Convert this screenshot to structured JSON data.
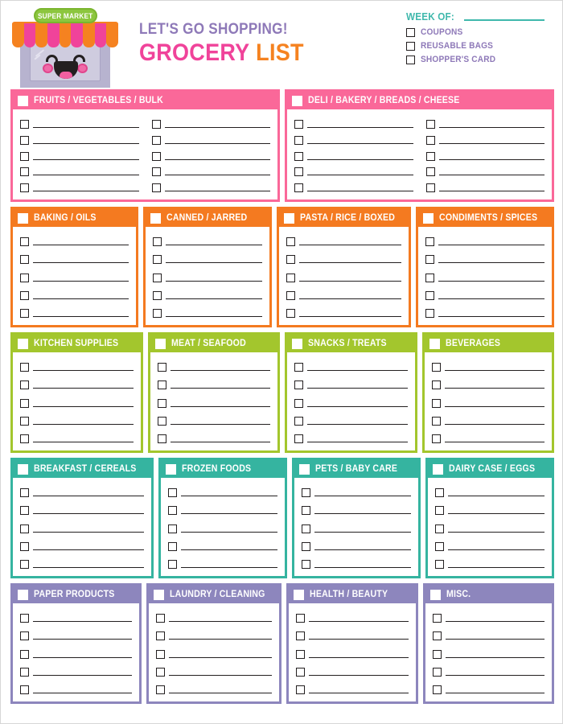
{
  "header": {
    "store_sign": "SUPER MARKET",
    "title_top": "LET'S GO SHOPPING!",
    "title_main_1": "GROCERY",
    "title_main_2": "LIST",
    "week_of_label": "WEEK OF:",
    "options": [
      {
        "label": "COUPONS"
      },
      {
        "label": "REUSABLE BAGS"
      },
      {
        "label": "SHOPPER'S CARD"
      }
    ]
  },
  "colors": {
    "pink": "#f9traverse",
    "pink_hex": "#fa6899",
    "orange": "#f47a20",
    "green": "#a3c62d",
    "teal": "#35b4a0",
    "purple": "#8d86bd",
    "title_purple": "#8e79b8",
    "title_pink": "#f0439a",
    "title_orange": "#f58220",
    "teal_text": "#3fb8ac"
  },
  "sections": [
    {
      "title": "FRUITS / VEGETABLES / BULK",
      "color": "#fa6899",
      "columns": 2,
      "rows": 5,
      "band": 0
    },
    {
      "title": "DELI / BAKERY / BREADS / CHEESE",
      "color": "#fa6899",
      "columns": 2,
      "rows": 5,
      "band": 0
    },
    {
      "title": "BAKING / OILS",
      "color": "#f47a20",
      "columns": 1,
      "rows": 5,
      "band": 1
    },
    {
      "title": "CANNED / JARRED",
      "color": "#f47a20",
      "columns": 1,
      "rows": 5,
      "band": 1
    },
    {
      "title": "PASTA / RICE / BOXED",
      "color": "#f47a20",
      "columns": 1,
      "rows": 5,
      "band": 1
    },
    {
      "title": "CONDIMENTS / SPICES",
      "color": "#f47a20",
      "columns": 1,
      "rows": 5,
      "band": 1
    },
    {
      "title": "KITCHEN SUPPLIES",
      "color": "#a3c62d",
      "columns": 1,
      "rows": 5,
      "band": 2
    },
    {
      "title": "MEAT / SEAFOOD",
      "color": "#a3c62d",
      "columns": 1,
      "rows": 5,
      "band": 2
    },
    {
      "title": "SNACKS / TREATS",
      "color": "#a3c62d",
      "columns": 1,
      "rows": 5,
      "band": 2
    },
    {
      "title": "BEVERAGES",
      "color": "#a3c62d",
      "columns": 1,
      "rows": 5,
      "band": 2
    },
    {
      "title": "BREAKFAST / CEREALS",
      "color": "#35b4a0",
      "columns": 1,
      "rows": 5,
      "band": 3
    },
    {
      "title": "FROZEN FOODS",
      "color": "#35b4a0",
      "columns": 1,
      "rows": 5,
      "band": 3
    },
    {
      "title": "PETS / BABY CARE",
      "color": "#35b4a0",
      "columns": 1,
      "rows": 5,
      "band": 3
    },
    {
      "title": "DAIRY CASE / EGGS",
      "color": "#35b4a0",
      "columns": 1,
      "rows": 5,
      "band": 3
    },
    {
      "title": "PAPER PRODUCTS",
      "color": "#8d86bd",
      "columns": 1,
      "rows": 5,
      "band": 4
    },
    {
      "title": "LAUNDRY / CLEANING",
      "color": "#8d86bd",
      "columns": 1,
      "rows": 5,
      "band": 4
    },
    {
      "title": "HEALTH / BEAUTY",
      "color": "#8d86bd",
      "columns": 1,
      "rows": 5,
      "band": 4
    },
    {
      "title": "MISC.",
      "color": "#8d86bd",
      "columns": 1,
      "rows": 5,
      "band": 4
    }
  ],
  "awning": {
    "stripes": [
      "#f58220",
      "#f0439a",
      "#f58220",
      "#f0439a",
      "#f58220",
      "#f0439a",
      "#f58220",
      "#f0439a",
      "#f58220"
    ]
  }
}
